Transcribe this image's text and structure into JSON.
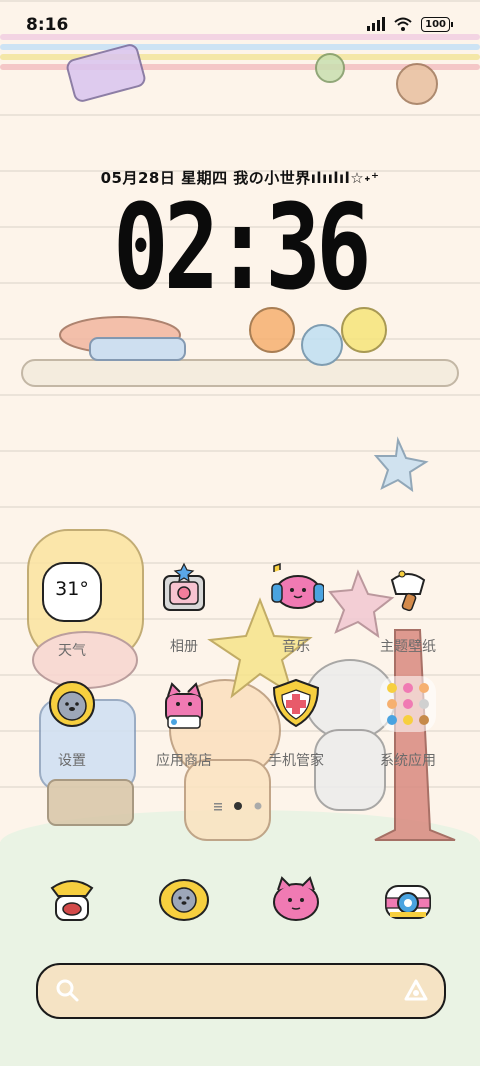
{
  "status": {
    "time": "8:16",
    "battery": "100"
  },
  "lockinfo": {
    "date_text": "05月28日  星期四  我の小世界ılıılıl☆˖⁺",
    "clock": "02:36"
  },
  "widgets": {
    "weather_temp": "31°"
  },
  "apps": [
    {
      "label": "天气",
      "icon": "weather-icon"
    },
    {
      "label": "相册",
      "icon": "gallery-icon"
    },
    {
      "label": "音乐",
      "icon": "music-icon"
    },
    {
      "label": "主题壁纸",
      "icon": "themes-icon"
    },
    {
      "label": "设置",
      "icon": "settings-icon"
    },
    {
      "label": "应用商店",
      "icon": "app-store-icon"
    },
    {
      "label": "手机管家",
      "icon": "security-icon"
    },
    {
      "label": "系统应用",
      "icon": "system-apps-folder-icon"
    }
  ],
  "dock": [
    {
      "icon": "phone-icon"
    },
    {
      "icon": "messages-icon"
    },
    {
      "icon": "browser-icon"
    },
    {
      "icon": "camera-icon"
    }
  ],
  "page_indicator": {
    "current": 2,
    "count": 3
  },
  "colors": {
    "background": "#fdf4ea",
    "ground": "#eaf3e4",
    "search_fill": "#f5e3c4",
    "accent_pink": "#f07ab3",
    "accent_yellow": "#f7cf3f"
  }
}
